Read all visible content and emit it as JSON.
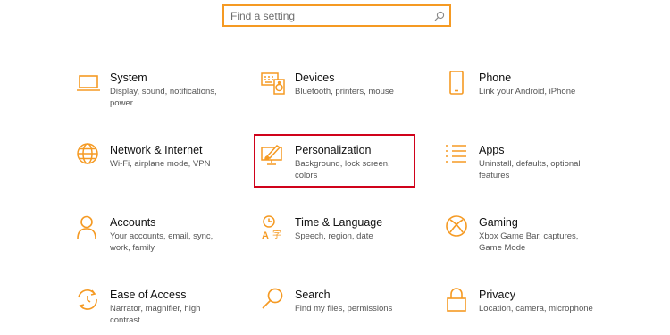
{
  "search": {
    "placeholder": "Find a setting"
  },
  "colors": {
    "accent": "#f59a23",
    "highlight": "#d0021b"
  },
  "tiles": [
    {
      "title": "System",
      "desc": "Display, sound, notifications, power",
      "icon": "laptop-icon"
    },
    {
      "title": "Devices",
      "desc": "Bluetooth, printers, mouse",
      "icon": "keyboard-speaker-icon"
    },
    {
      "title": "Phone",
      "desc": "Link your Android, iPhone",
      "icon": "phone-icon"
    },
    {
      "title": "Network & Internet",
      "desc": "Wi-Fi, airplane mode, VPN",
      "icon": "globe-icon"
    },
    {
      "title": "Personalization",
      "desc": "Background, lock screen, colors",
      "icon": "paint-monitor-icon"
    },
    {
      "title": "Apps",
      "desc": "Uninstall, defaults, optional features",
      "icon": "apps-list-icon"
    },
    {
      "title": "Accounts",
      "desc": "Your accounts, email, sync, work, family",
      "icon": "person-icon"
    },
    {
      "title": "Time & Language",
      "desc": "Speech, region, date",
      "icon": "time-language-icon"
    },
    {
      "title": "Gaming",
      "desc": "Xbox Game Bar, captures, Game Mode",
      "icon": "xbox-icon"
    },
    {
      "title": "Ease of Access",
      "desc": "Narrator, magnifier, high contrast",
      "icon": "ease-of-access-icon"
    },
    {
      "title": "Search",
      "desc": "Find my files, permissions",
      "icon": "search-icon"
    },
    {
      "title": "Privacy",
      "desc": "Location, camera, microphone",
      "icon": "lock-icon"
    }
  ]
}
